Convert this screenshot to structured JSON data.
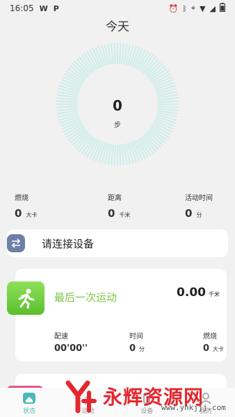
{
  "status_bar": {
    "time": "16:05",
    "icon_w": "W",
    "icon_p": "P",
    "battery_level": 0.8
  },
  "page": {
    "title": "今天"
  },
  "steps": {
    "value": "0",
    "unit": "步"
  },
  "stats": [
    {
      "label": "燃烧",
      "value": "0",
      "unit": "大卡"
    },
    {
      "label": "距离",
      "value": "0",
      "unit": "千米"
    },
    {
      "label": "活动时间",
      "value": "0",
      "unit": "分"
    }
  ],
  "connect": {
    "label": "请连接设备"
  },
  "last_sport": {
    "title": "最后一次运动",
    "distance": "0.00",
    "distance_unit": "千米",
    "pace_label": "配速",
    "pace_value": "00'00''",
    "time_label": "时间",
    "time_value": "0",
    "time_unit": "分",
    "burn_label": "燃烧",
    "burn_value": "0",
    "burn_unit": "大卡"
  },
  "nav": [
    {
      "label": "状态",
      "icon": "home-icon",
      "active": true
    },
    {
      "label": "运动",
      "icon": "run-icon",
      "active": false
    },
    {
      "label": "设备",
      "icon": "device-icon",
      "active": false
    },
    {
      "label": "我的",
      "icon": "user-icon",
      "active": false
    }
  ],
  "watermark": {
    "text": "永辉资源网",
    "url": "www.yhkjjj.com"
  },
  "colors": {
    "ring": "#cfeeea",
    "accent": "#4cb8b8",
    "sport_green": "#7cc644",
    "watermark_red": "#e4272f"
  }
}
